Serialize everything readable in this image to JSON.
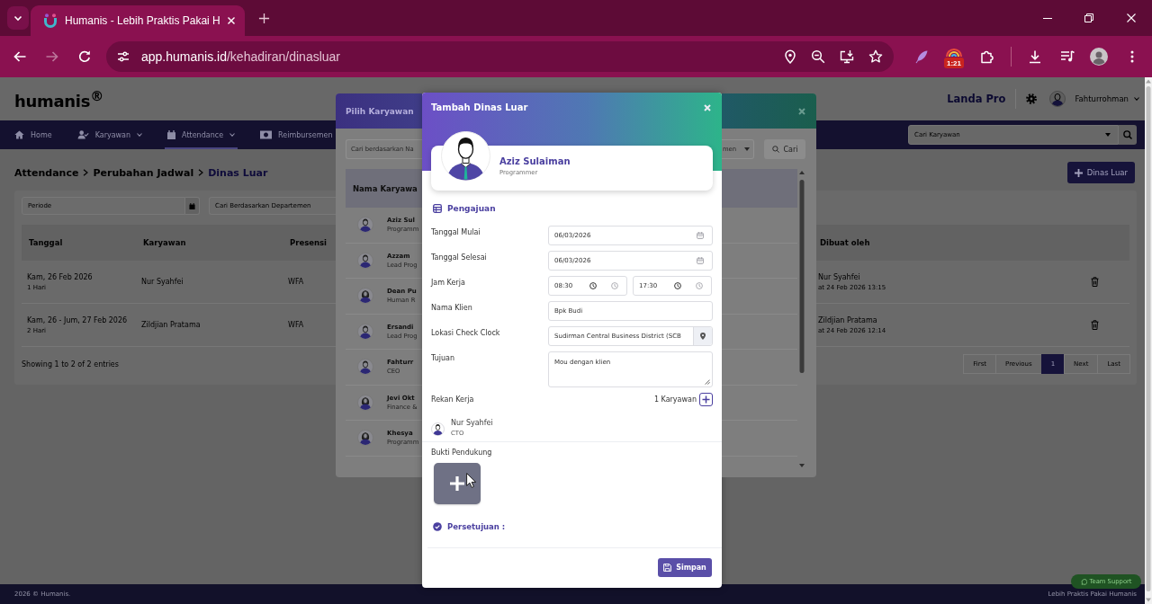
{
  "browser": {
    "tab_title": "Humanis - Lebih Praktis Pakai H",
    "forward_enabled": false,
    "url_host": "app.humanis.id",
    "url_path": "/kehadiran/dinasluar",
    "extension_badge": "1:21"
  },
  "header": {
    "logo": "humanis$^{®}$",
    "company": "Landa Pro",
    "user": "Fahturrohman"
  },
  "nav": {
    "items": [
      {
        "label": "Home",
        "dropdown": false,
        "selected": false
      },
      {
        "label": "Karyawan",
        "dropdown": true,
        "selected": false
      },
      {
        "label": "Attendance",
        "dropdown": true,
        "selected": true
      },
      {
        "label": "Reimbursemen",
        "dropdown": false,
        "selected": false
      }
    ],
    "search_placeholder": "Cari Karyawan"
  },
  "breadcrumb": [
    {
      "label": "Attendance",
      "current": false
    },
    {
      "label": "Perubahan Jadwal",
      "current": false
    },
    {
      "label": "Dinas Luar",
      "current": true
    }
  ],
  "add_button": "Dinas Luar",
  "filters": {
    "period_placeholder": "Periode",
    "department_placeholder": "Cari Berdasarkan Departemen"
  },
  "table": {
    "columns": [
      "Tanggal",
      "Karyawan",
      "Presensi",
      "Dibuat oleh"
    ],
    "rows": [
      {
        "date": "Kam, 26 Feb 2026",
        "duration": "1 Hari",
        "employee": "Nur Syahfei",
        "presence": "WFA",
        "created_by": "Nur Syahfei",
        "created_at": "at 24 Feb 2026 13:15"
      },
      {
        "date": "Kam, 26 - Jum, 27 Feb 2026",
        "duration": "2 Hari",
        "employee": "Zildjian Pratama",
        "presence": "WFA",
        "created_by": "Zildjian Pratama",
        "created_at": "at 24 Feb 2026 12:14"
      }
    ],
    "info": "Showing 1 to 2 of 2 entries"
  },
  "pagination": [
    {
      "label": "First",
      "selected": false
    },
    {
      "label": "Previous",
      "selected": false
    },
    {
      "label": "1",
      "selected": true
    },
    {
      "label": "Next",
      "selected": false
    },
    {
      "label": "Last",
      "selected": false
    }
  ],
  "footer": {
    "copyright": "2026 © Humanis.",
    "tagline": "Lebih Praktis Pakai Humanis",
    "support_button": "Team Support"
  },
  "employee_dialog": {
    "title": "Pilih Karyawan",
    "search_placeholder": "Cari berdasarkan Na",
    "department_filter": "men",
    "search_button": "Cari",
    "column": "Nama Karyawa",
    "employees": [
      {
        "name": "Aziz Sul",
        "role": "Programm",
        "kind": "male"
      },
      {
        "name": "Azzam",
        "role": "Lead Prog",
        "kind": "male"
      },
      {
        "name": "Dean Pu",
        "role": "Human R",
        "kind": "female"
      },
      {
        "name": "Ersandi",
        "role": "Lead Prog",
        "kind": "male"
      },
      {
        "name": "Fahturr",
        "role": "CEO",
        "kind": "male"
      },
      {
        "name": "Jevi Okt",
        "role": "Finance &",
        "kind": "female"
      },
      {
        "name": "Khesya",
        "role": "Programm",
        "kind": "female"
      }
    ]
  },
  "form_dialog": {
    "title": "Tambah Dinas Luar",
    "employee": {
      "name": "Aziz Sulaiman",
      "role": "Programmer"
    },
    "section": "Pengajuan",
    "fields": [
      {
        "kind": "date",
        "label": "Tanggal Mulai",
        "value": "06/03/2026"
      },
      {
        "kind": "date",
        "label": "Tanggal Selesai",
        "value": "06/03/2026"
      },
      {
        "kind": "time_range",
        "label": "Jam Kerja",
        "start": "08:30",
        "end": "17:30"
      },
      {
        "kind": "text",
        "label": "Nama Klien",
        "value": "Bpk Budi"
      },
      {
        "kind": "location",
        "label": "Lokasi Check Clock",
        "value": "Sudirman Central Business District (SCB"
      },
      {
        "kind": "textarea",
        "label": "Tujuan",
        "value": "Mou dengan klien"
      }
    ],
    "coworkers": {
      "label": "Rekan Kerja",
      "count": "1 Karyawan",
      "people": [
        {
          "name": "Nur Syahfei",
          "role": "CTO"
        }
      ]
    },
    "attachment_label": "Bukti Pendukung",
    "approval_label": "Persetujuan :",
    "save_button": "Simpan"
  }
}
